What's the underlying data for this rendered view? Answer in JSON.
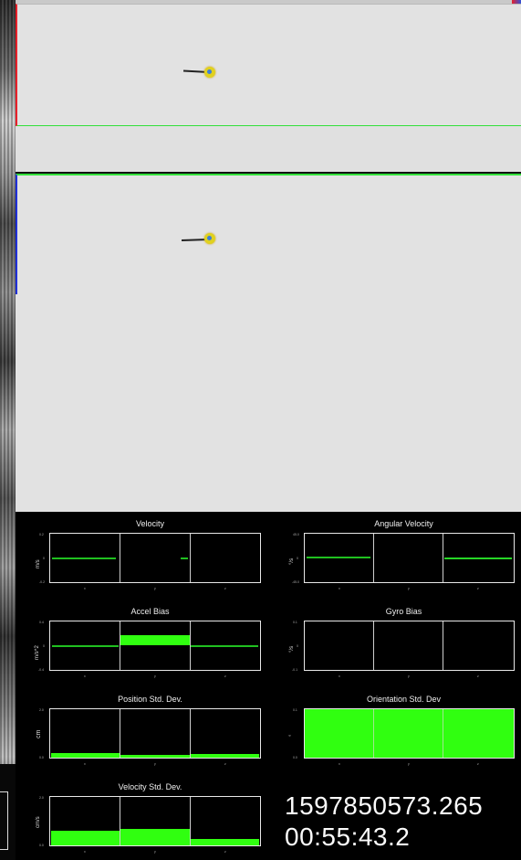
{
  "plots": {
    "velocity": {
      "title": "Velocity",
      "ylabel": "m/s",
      "yticks": [
        "0.2",
        "0",
        "-0.2"
      ],
      "xticks": [
        "x",
        "y",
        "z"
      ]
    },
    "angular_velocity": {
      "title": "Angular Velocity",
      "ylabel": "°/s",
      "yticks": [
        "45.0",
        "0",
        "-45.0"
      ],
      "xticks": [
        "x",
        "y",
        "z"
      ]
    },
    "accel_bias": {
      "title": "Accel Bias",
      "ylabel": "m/s^2",
      "yticks": [
        "0.4",
        "0",
        "-0.4"
      ],
      "xticks": [
        "x",
        "y",
        "z"
      ]
    },
    "gyro_bias": {
      "title": "Gyro Bias",
      "ylabel": "°/s",
      "yticks": [
        "0.1",
        "0",
        "-0.1"
      ],
      "xticks": [
        "x",
        "y",
        "z"
      ]
    },
    "position_std": {
      "title": "Position Std. Dev.",
      "ylabel": "cm",
      "yticks": [
        "2.0",
        "0.0"
      ],
      "xticks": [
        "x",
        "y",
        "z"
      ]
    },
    "orientation_std": {
      "title": "Orientation Std. Dev",
      "ylabel": "°",
      "yticks": [
        "0.1",
        "0.0"
      ],
      "xticks": [
        "x",
        "y",
        "z"
      ]
    },
    "velocity_std": {
      "title": "Velocity Std. Dev.",
      "ylabel": "cm/s",
      "yticks": [
        "2.0",
        "0.0"
      ],
      "xticks": [
        "x",
        "y",
        "z"
      ]
    }
  },
  "timestamp": {
    "unix": "1597850573.265",
    "clock": "00:55:43.2"
  },
  "colors": {
    "plot_fill": "#30ff10",
    "panel_bg": "#e2e2e2",
    "marker": "#e0d11f",
    "axis_red": "#e8202a",
    "axis_green": "#32e03a",
    "axis_blue": "#2030d8"
  }
}
